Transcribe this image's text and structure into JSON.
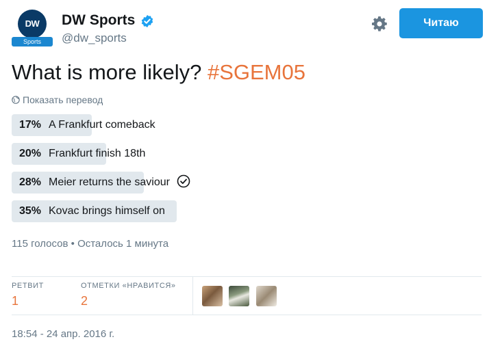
{
  "account": {
    "logo_text": "DW",
    "logo_band": "Sports",
    "name": "DW Sports",
    "handle": "@dw_sports"
  },
  "actions": {
    "follow_label": "Читаю",
    "settings_icon": "gear-icon"
  },
  "tweet": {
    "text": "What is more likely? ",
    "hashtag": "#SGEM05",
    "translate_label": "Показать перевод"
  },
  "poll": {
    "options": [
      {
        "pct": "17",
        "label": "A Frankfurt comeback",
        "share": 0.17
      },
      {
        "pct": "20",
        "label": "Frankfurt finish 18th",
        "share": 0.2
      },
      {
        "pct": "28",
        "label": "Meier returns the saviour",
        "share": 0.28,
        "selected": true
      },
      {
        "pct": "35",
        "label": "Kovac brings himself on",
        "share": 0.35
      }
    ],
    "meta": "115 голосов • Осталось 1 минута"
  },
  "stats": {
    "retweets_label": "РЕТВИТ",
    "retweets_value": "1",
    "likes_label": "ОТМЕТКИ «НРАВИТСЯ»",
    "likes_value": "2"
  },
  "timestamp": "18:54 - 24 апр. 2016 г.",
  "colors": {
    "accent": "#1b95e0",
    "hashtag": "#e8743b",
    "poll_bar": "#e1e8ed",
    "muted": "#657786"
  }
}
